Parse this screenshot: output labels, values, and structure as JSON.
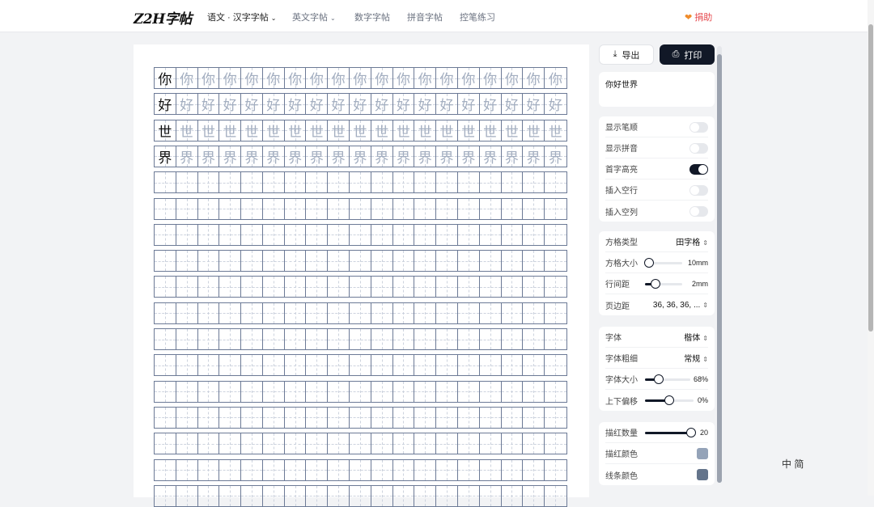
{
  "app": {
    "logo": "Z2H字帖"
  },
  "nav": {
    "items": [
      {
        "label": "语文 · 汉字字帖",
        "dropdown": true,
        "active": true
      },
      {
        "label": "英文字帖",
        "dropdown": true,
        "active": false
      },
      {
        "label": "数字字帖",
        "dropdown": false,
        "active": false
      },
      {
        "label": "拼音字帖",
        "dropdown": false,
        "active": false
      },
      {
        "label": "控笔练习",
        "dropdown": false,
        "active": false
      }
    ],
    "donate": "捐助"
  },
  "worksheet": {
    "characters": [
      "你",
      "好",
      "世",
      "界"
    ],
    "columns": 19,
    "empty_rows_visible": 13
  },
  "toolbar": {
    "export_label": "导出",
    "print_label": "打印"
  },
  "text_input": {
    "value": "你好世界"
  },
  "toggles": [
    {
      "label": "显示笔顺",
      "on": false
    },
    {
      "label": "显示拼音",
      "on": false
    },
    {
      "label": "首字高亮",
      "on": true
    },
    {
      "label": "插入空行",
      "on": false
    },
    {
      "label": "插入空列",
      "on": false
    }
  ],
  "grid_settings": {
    "grid_type": {
      "label": "方格类型",
      "value": "田字格"
    },
    "grid_size": {
      "label": "方格大小",
      "value": "10mm",
      "level": 0.1
    },
    "line_spacing": {
      "label": "行间距",
      "value": "2mm",
      "level": 0.28
    },
    "margin": {
      "label": "页边距",
      "value": "36, 36, 36, ..."
    }
  },
  "font_settings": {
    "font": {
      "label": "字体",
      "value": "楷体"
    },
    "weight": {
      "label": "字体粗细",
      "value": "常规"
    },
    "size": {
      "label": "字体大小",
      "value": "68%",
      "level": 0.3
    },
    "offset": {
      "label": "上下偏移",
      "value": "0%",
      "level": 0.5
    }
  },
  "trace_settings": {
    "count": {
      "label": "描红数量",
      "value": "20",
      "level": 1.0
    },
    "trace_color": {
      "label": "描红颜色",
      "color": "#94a3b8"
    },
    "line_color": {
      "label": "线条颜色",
      "color": "#64748b"
    }
  },
  "ime": {
    "text": "中 简"
  },
  "colors": {
    "accent": "#111827",
    "donate": "#e5484d"
  }
}
